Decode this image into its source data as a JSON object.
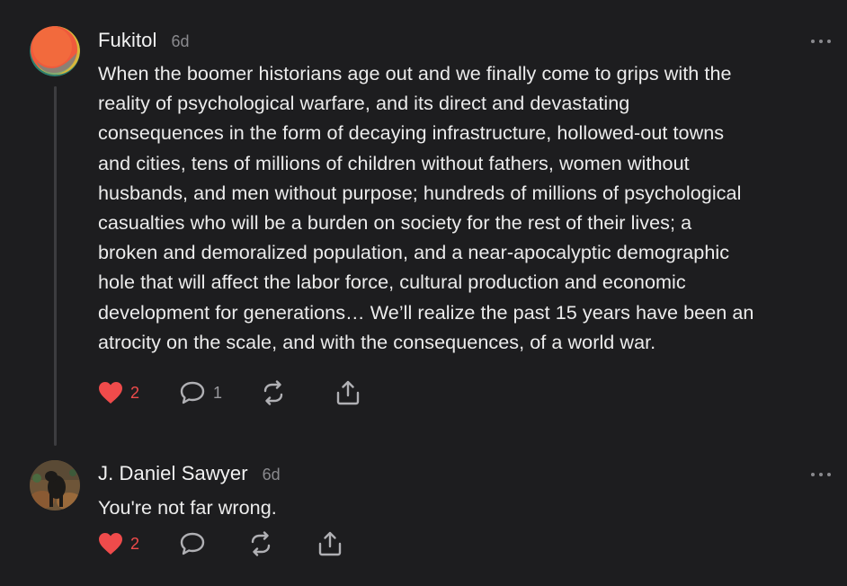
{
  "comments": [
    {
      "author": "Fukitol",
      "time": "6d",
      "avatar_icon": "orange-circle-avatar",
      "text": "When the boomer historians age out and we finally come to grips with the\nreality of psychological warfare, and its direct and devastating\nconsequences in the form of decaying infrastructure, hollowed-out towns\nand cities, tens of millions of children without fathers, women without\nhusbands, and men without purpose; hundreds of millions of psychological\ncasualties who will be a burden on society for the rest of their lives; a\nbroken and demoralized population, and a near-apocalyptic demographic\nhole that will affect the labor force, cultural production and economic\ndevelopment for generations… We’ll realize the past 15 years have been an\natrocity on the scale, and with the consequences, of a world war.",
      "likes": "2",
      "replies": "1"
    },
    {
      "author": "J. Daniel Sawyer",
      "time": "6d",
      "avatar_icon": "dog-photo-avatar",
      "text": "You're not far wrong.",
      "likes": "2",
      "replies": ""
    }
  ],
  "colors": {
    "background": "#1d1d1f",
    "like": "#ef4b4b",
    "muted": "#8a8a8e",
    "text": "#ececec"
  }
}
